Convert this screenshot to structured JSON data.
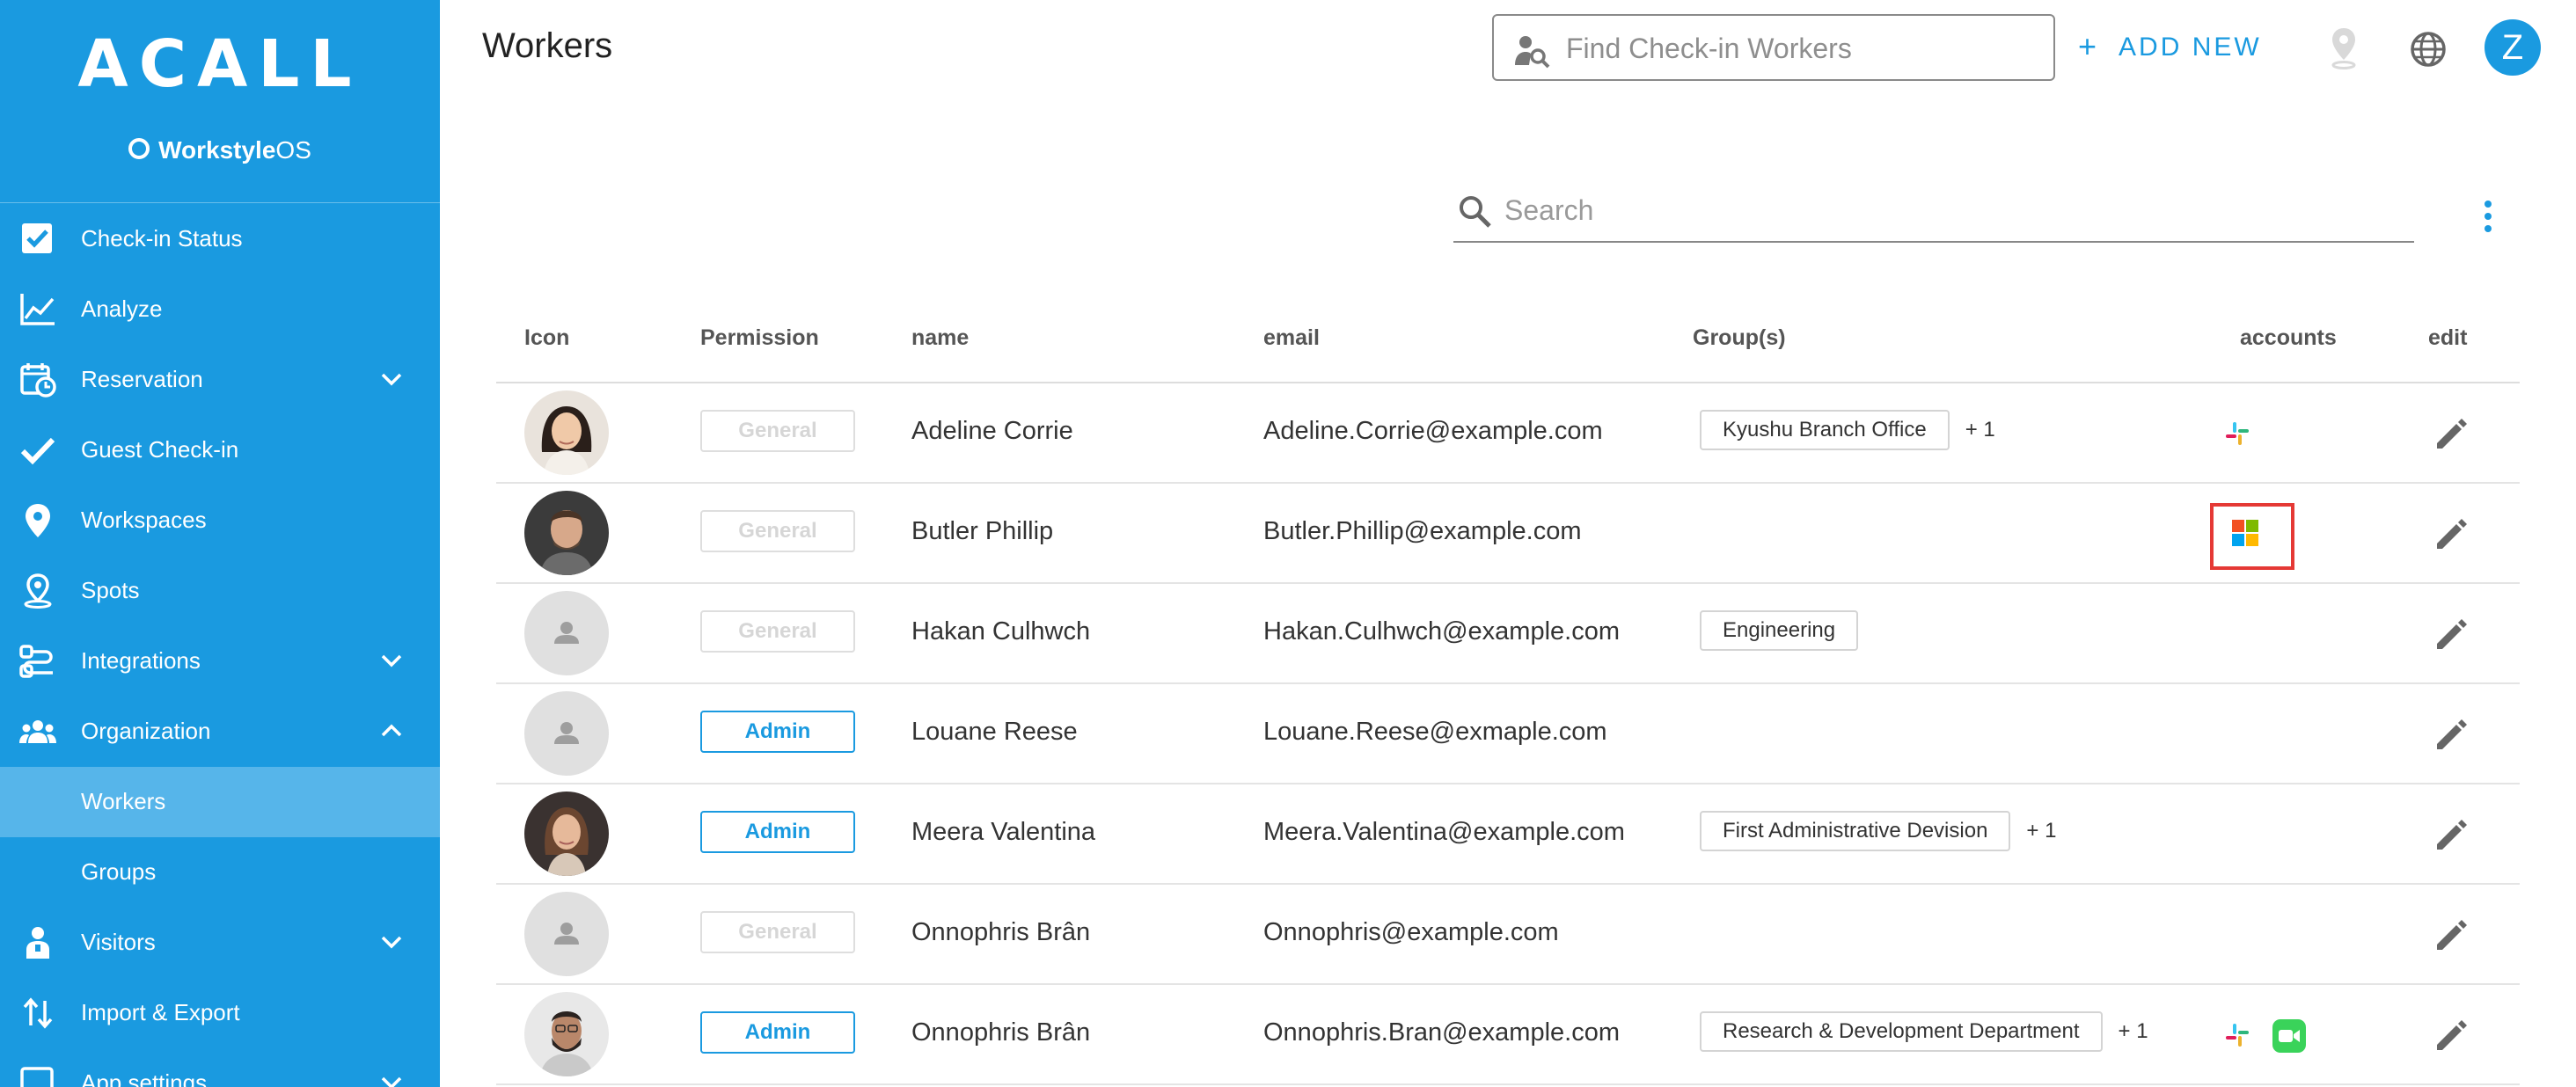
{
  "brand": {
    "logo": "ACALL",
    "sub_bold": "Workstyle",
    "sub_regular": "OS"
  },
  "sidebar": {
    "items": [
      {
        "label": "Check-in Status",
        "icon": "checkbox-icon"
      },
      {
        "label": "Analyze",
        "icon": "chart-icon"
      },
      {
        "label": "Reservation",
        "icon": "calendar-clock-icon",
        "expandable": true
      },
      {
        "label": "Guest Check-in",
        "icon": "check-icon"
      },
      {
        "label": "Workspaces",
        "icon": "location-pin-icon"
      },
      {
        "label": "Spots",
        "icon": "spot-pin-icon"
      },
      {
        "label": "Integrations",
        "icon": "integrations-icon",
        "expandable": true
      },
      {
        "label": "Organization",
        "icon": "people-icon",
        "expanded": true
      },
      {
        "label": "Workers",
        "active": true
      },
      {
        "label": "Groups"
      },
      {
        "label": "Visitors",
        "icon": "visitor-icon",
        "expandable": true
      },
      {
        "label": "Import & Export",
        "icon": "import-export-icon"
      },
      {
        "label": "App settings",
        "icon": "app-settings-icon",
        "expandable": true
      }
    ]
  },
  "header": {
    "title": "Workers",
    "find_placeholder": "Find Check-in Workers",
    "add_new": "ADD NEW",
    "avatar_initial": "Z"
  },
  "search": {
    "placeholder": "Search"
  },
  "table": {
    "headers": {
      "icon": "Icon",
      "permission": "Permission",
      "name": "name",
      "email": "email",
      "groups": "Group(s)",
      "accounts": "accounts",
      "edit": "edit"
    },
    "rows": [
      {
        "avatar": "photo-woman-1",
        "permission": "General",
        "name": "Adeline Corrie",
        "email": "Adeline.Corrie@example.com",
        "group": "Kyushu Branch Office",
        "more": "+ 1",
        "accounts": [
          "slack"
        ]
      },
      {
        "avatar": "photo-man-1",
        "permission": "General",
        "name": "Butler Phillip",
        "email": "Butler.Phillip@example.com",
        "group": "",
        "more": "",
        "accounts": [
          "microsoft"
        ],
        "highlighted_account": true
      },
      {
        "avatar": "placeholder",
        "permission": "General",
        "name": "Hakan Culhwch",
        "email": "Hakan.Culhwch@example.com",
        "group": "Engineering",
        "more": "",
        "accounts": []
      },
      {
        "avatar": "placeholder",
        "permission": "Admin",
        "name": "Louane Reese",
        "email": "Louane.Reese@exmaple.com",
        "group": "",
        "more": "",
        "accounts": []
      },
      {
        "avatar": "photo-woman-2",
        "permission": "Admin",
        "name": "Meera Valentina",
        "email": "Meera.Valentina@example.com",
        "group": "First Administrative Devision",
        "more": "+ 1",
        "accounts": []
      },
      {
        "avatar": "placeholder",
        "permission": "General",
        "name": "Onnophris Brân",
        "email": "Onnophris@example.com",
        "group": "",
        "more": "",
        "accounts": []
      },
      {
        "avatar": "photo-man-2",
        "permission": "Admin",
        "name": "Onnophris Brân",
        "email": "Onnophris.Bran@example.com",
        "group": "Research & Development Department",
        "more": "+ 1",
        "accounts": [
          "slack",
          "facetime"
        ]
      }
    ]
  },
  "colors": {
    "accent": "#1a9ae0",
    "sidebar_active": "#56b5ea",
    "highlight": "#e53935"
  }
}
